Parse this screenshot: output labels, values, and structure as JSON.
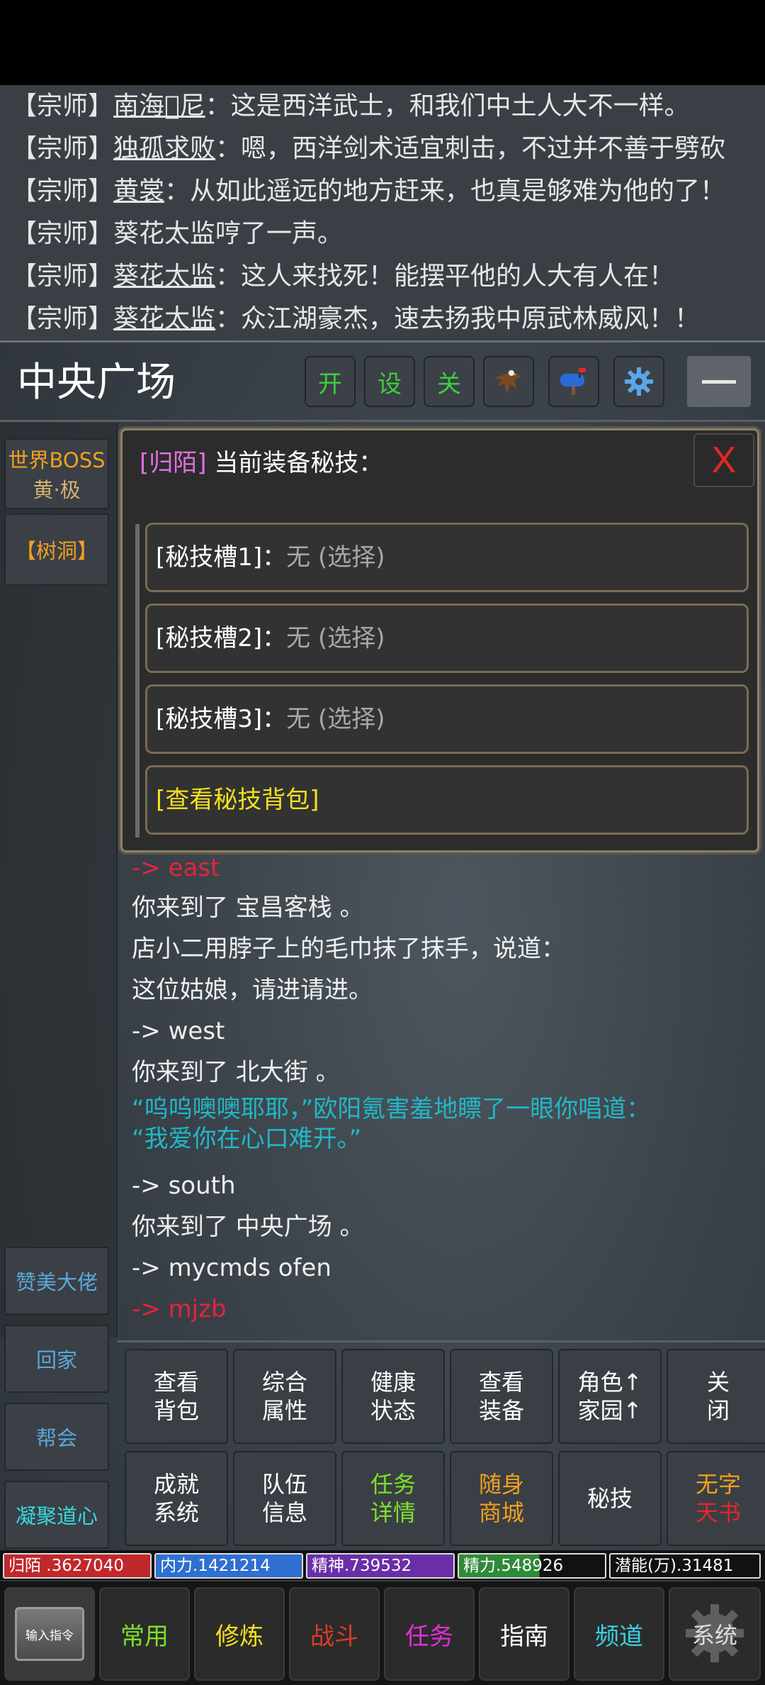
{
  "chat": [
    {
      "prefix": "【宗师】",
      "name": "南海𫊸尼",
      "text": "：这是西洋武士，和我们中土人大不一样。"
    },
    {
      "prefix": "【宗师】",
      "name": "独孤求败",
      "text": "：嗯，西洋剑术适宜刺击，不过并不善于劈砍"
    },
    {
      "prefix": "【宗师】",
      "name": "黄裳",
      "text": "：从如此遥远的地方赶来，也真是够难为他的了！"
    },
    {
      "prefix": "【宗师】",
      "name": "",
      "text": "葵花太监哼了一声。"
    },
    {
      "prefix": "【宗师】",
      "name": "葵花太监",
      "text": "：这人来找死！能摆平他的人大有人在！"
    },
    {
      "prefix": "【宗师】",
      "name": "葵花太监",
      "text": "：众江湖豪杰，速去扬我中原武林威风！！"
    }
  ],
  "header": {
    "room_title": "中央广场",
    "buttons": [
      {
        "label": "开",
        "icon": ""
      },
      {
        "label": "设",
        "icon": ""
      },
      {
        "label": "关",
        "icon": ""
      },
      {
        "label": "",
        "icon": "eagle-icon"
      },
      {
        "label": "",
        "icon": "mailbox-icon"
      },
      {
        "label": "",
        "icon": "gear-icon"
      }
    ]
  },
  "sidebar": {
    "boss_line1": "世界BOSS",
    "boss_line2": "黄·极",
    "tree_hole": "【树洞】",
    "praise": "赞美大佬",
    "home": "回家",
    "guild": "帮会",
    "condense": "凝聚道心"
  },
  "modal": {
    "title_prefix": "[归陌]",
    "title_text": " 当前装备秘技：",
    "close": "X",
    "slots": [
      {
        "label": "[秘技槽1]：",
        "value": "无 (选择)"
      },
      {
        "label": "[秘技槽2]：",
        "value": "无 (选择)"
      },
      {
        "label": "[秘技槽3]：",
        "value": "无 (选择)"
      }
    ],
    "bag_button": "[查看秘技背包]"
  },
  "log": [
    "-> east",
    "你来到了 宝昌客栈 。",
    "店小二用脖子上的毛巾抹了抹手，说道：",
    "这位姑娘，请进请进。",
    "-> west",
    "你来到了 北大街 。",
    "“呜呜噢噢耶耶，”欧阳氪害羞地瞟了一眼你唱道：",
    "“我爱你在心口难开。”",
    "-> south",
    "你来到了 中央广场 。",
    "-> mycmds ofen",
    "-> mjzb"
  ],
  "grid": [
    {
      "label": "查看\n背包",
      "color": "#ffffff"
    },
    {
      "label": "综合\n属性",
      "color": "#ffffff"
    },
    {
      "label": "健康\n状态",
      "color": "#ffffff"
    },
    {
      "label": "查看\n装备",
      "color": "#ffffff"
    },
    {
      "label": "角色↑\n家园↑",
      "color": "#ffffff"
    },
    {
      "label": "关\n闭",
      "color": "#ffffff"
    },
    {
      "label": "成就\n系统",
      "color": "#ffffff"
    },
    {
      "label": "队伍\n信息",
      "color": "#ffffff"
    },
    {
      "label": "任务\n详情",
      "color": "#7de02a"
    },
    {
      "label": "随身\n商城",
      "color": "#f0a020"
    },
    {
      "label": "秘技",
      "color": "#ffffff"
    },
    {
      "label": "无字\n天书",
      "color": "#f0a020"
    }
  ],
  "stats": [
    {
      "label": "归陌 .3627040",
      "fill": "#c0282c",
      "ratio": 1.0
    },
    {
      "label": "内力.1421214",
      "fill": "#2f6fd0",
      "ratio": 1.0
    },
    {
      "label": "精神.739532",
      "fill": "#6a2fa8",
      "ratio": 1.0
    },
    {
      "label": "精力.548926",
      "fill": "#2f8a3a",
      "ratio": 0.55
    },
    {
      "label": "潜能(万).31481",
      "fill": "#111111",
      "ratio": 1.0
    }
  ],
  "nav": {
    "input": "输入指令",
    "items": [
      {
        "label": "常用",
        "color": "#7de02a"
      },
      {
        "label": "修炼",
        "color": "#f2e020"
      },
      {
        "label": "战斗",
        "color": "#e03a2a"
      },
      {
        "label": "任务",
        "color": "#e030d8"
      },
      {
        "label": "指南",
        "color": "#ffffff"
      },
      {
        "label": "频道",
        "color": "#38d0e0"
      }
    ],
    "system": "系统"
  }
}
